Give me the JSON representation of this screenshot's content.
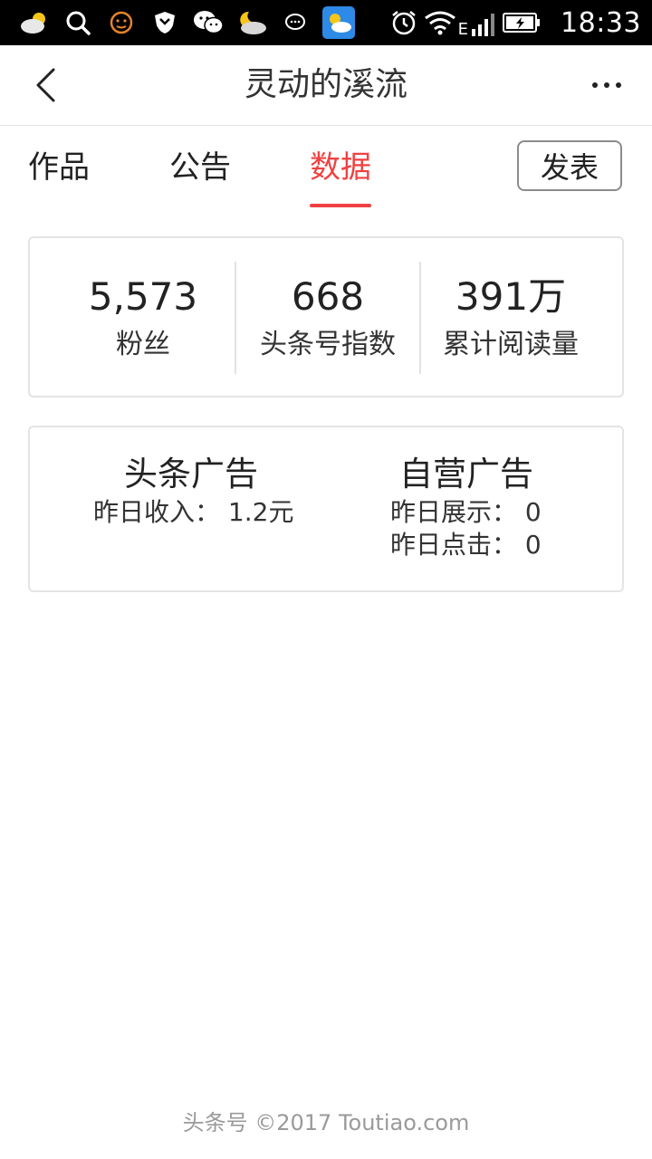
{
  "status_bar": {
    "icons": [
      "weather-cloud-sun-icon",
      "search-icon",
      "emoji-face-icon",
      "shield-icon",
      "wechat-icon",
      "weather-moon-cloud-icon",
      "chat-bubble-icon",
      "weather-app-icon"
    ],
    "status_icons": [
      "alarm-icon",
      "wifi-icon",
      "signal-icon",
      "battery-charging-icon"
    ],
    "network_label": "E",
    "time": "18:33"
  },
  "header": {
    "title": "灵动的溪流"
  },
  "tabs": {
    "items": [
      {
        "label": "作品"
      },
      {
        "label": "公告"
      },
      {
        "label": "数据"
      }
    ],
    "active_label": "数据",
    "publish_label": "发表"
  },
  "stats": [
    {
      "value": "5,573",
      "label": "粉丝"
    },
    {
      "value": "668",
      "label": "头条号指数"
    },
    {
      "value": "391万",
      "label": "累计阅读量"
    }
  ],
  "ads": {
    "toutiao": {
      "title": "头条广告",
      "income_label": "昨日收入：",
      "income_value": "1.2元"
    },
    "self": {
      "title": "自营广告",
      "display_label": "昨日展示：",
      "display_value": "0",
      "click_label": "昨日点击：",
      "click_value": "0"
    }
  },
  "footer": {
    "text": "头条号 ©2017 Toutiao.com"
  },
  "colors": {
    "accent": "#f04142",
    "status_bar_bg": "#000000",
    "border": "#e4e4e4",
    "footer_text": "#9a9a9a"
  }
}
